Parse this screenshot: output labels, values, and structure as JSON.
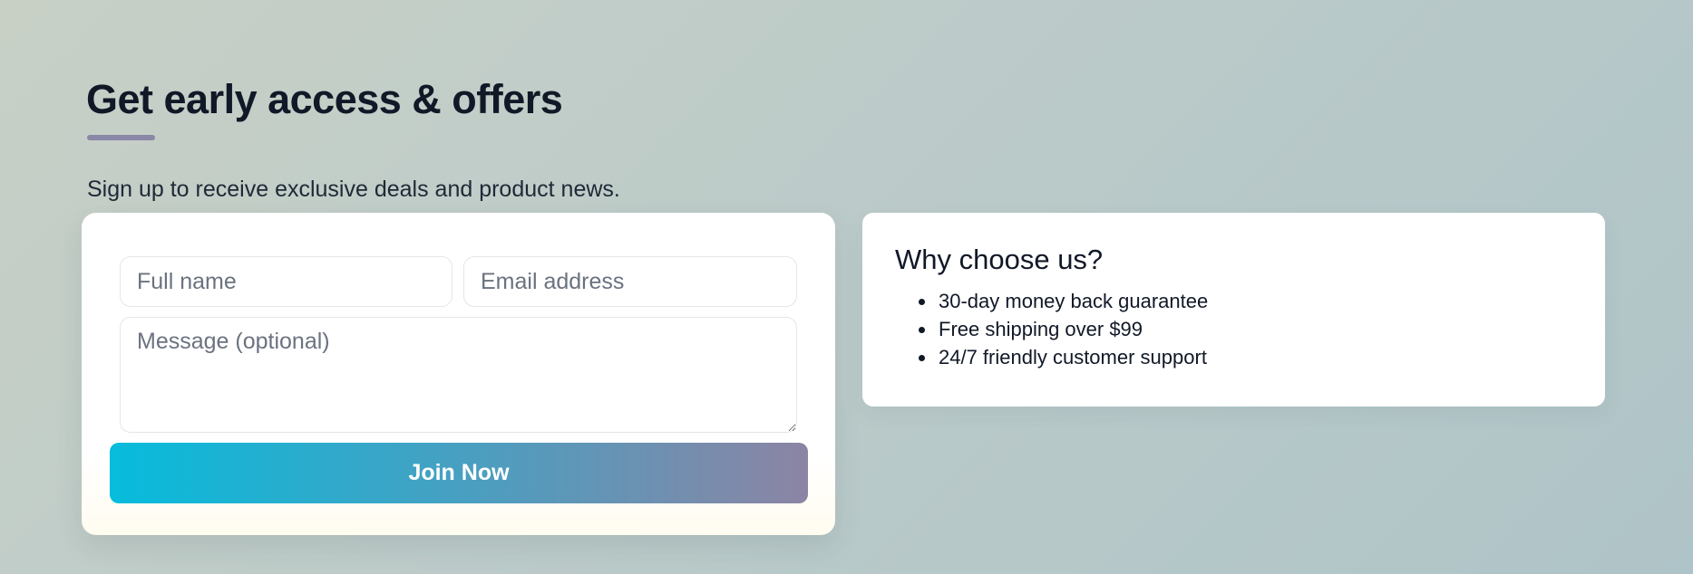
{
  "header": {
    "title": "Get early access & offers",
    "subtitle": "Sign up to receive exclusive deals and product news."
  },
  "form": {
    "name_placeholder": "Full name",
    "email_placeholder": "Email address",
    "message_placeholder": "Message (optional)",
    "submit_label": "Join Now"
  },
  "benefits": {
    "title": "Why choose us?",
    "items": [
      "30-day money back guarantee",
      "Free shipping over $99",
      "24/7 friendly customer support"
    ]
  },
  "colors": {
    "accent_underline": "#8a87a8",
    "button_gradient_start": "#06bcdc",
    "button_gradient_end": "#8c84a4",
    "heading": "#111827"
  },
  "icons": {
    "bullet": "bullet-icon",
    "resize": "textarea-resize-handle"
  }
}
